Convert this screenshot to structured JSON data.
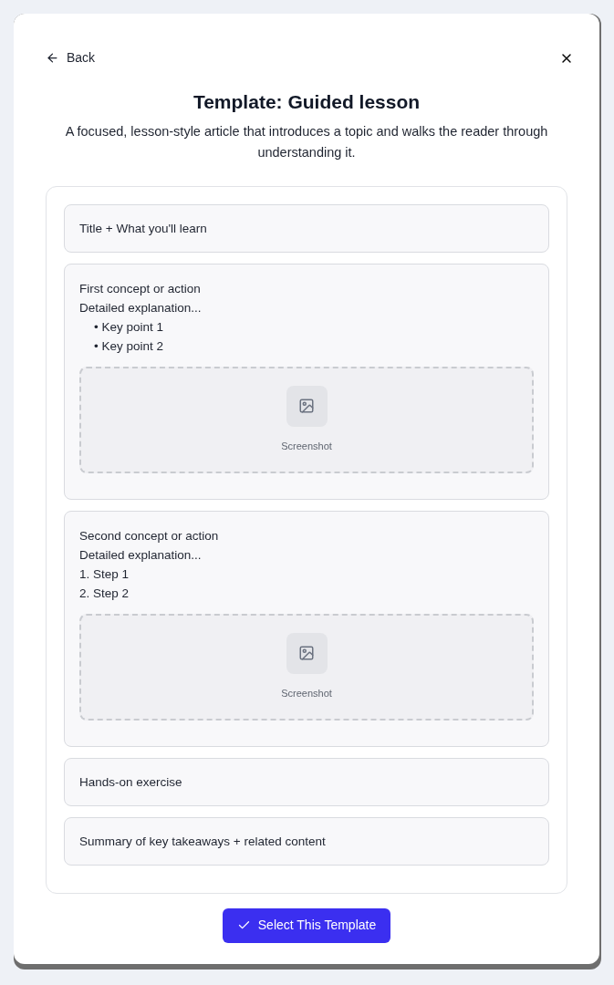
{
  "header": {
    "back_label": "Back"
  },
  "title": "Template: Guided lesson",
  "description": "A focused, lesson-style article that introduces a topic and walks the reader through understanding it.",
  "sections": [
    {
      "kind": "simple",
      "lines": [
        {
          "kind": "text",
          "text": "Title + What you'll learn"
        }
      ]
    },
    {
      "kind": "detailed",
      "lines": [
        {
          "kind": "text",
          "text": "First concept or action"
        },
        {
          "kind": "text",
          "text": "Detailed explanation..."
        },
        {
          "kind": "indented",
          "text": "• Key point 1"
        },
        {
          "kind": "indented",
          "text": "• Key point 2"
        }
      ],
      "placeholder_label": "Screenshot"
    },
    {
      "kind": "detailed",
      "lines": [
        {
          "kind": "text",
          "text": "Second concept or action"
        },
        {
          "kind": "text",
          "text": "Detailed explanation..."
        },
        {
          "kind": "text",
          "text": "1. Step 1"
        },
        {
          "kind": "text",
          "text": "2. Step 2"
        }
      ],
      "placeholder_label": "Screenshot"
    },
    {
      "kind": "simple",
      "lines": [
        {
          "kind": "text",
          "text": "Hands-on exercise"
        }
      ]
    },
    {
      "kind": "simple",
      "lines": [
        {
          "kind": "text",
          "text": "Summary of key takeaways + related content"
        }
      ]
    }
  ],
  "select_button": "Select This Template"
}
